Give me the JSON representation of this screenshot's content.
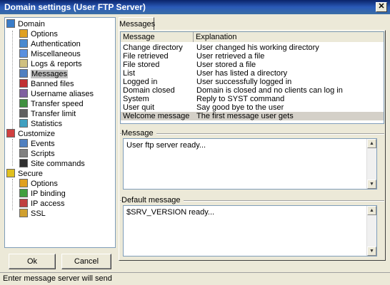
{
  "window": {
    "title": "Domain settings (User FTP Server)"
  },
  "tree": {
    "items": [
      {
        "label": "Domain",
        "icon": "domain-icon",
        "color": "#3a7dc9"
      },
      {
        "label": "Options",
        "icon": "options-icon",
        "color": "#e0a020"
      },
      {
        "label": "Authentication",
        "icon": "authentication-icon",
        "color": "#4a8ad0"
      },
      {
        "label": "Miscellaneous",
        "icon": "miscellaneous-icon",
        "color": "#5a90e0"
      },
      {
        "label": "Logs & reports",
        "icon": "logs-reports-icon",
        "color": "#d0c080"
      },
      {
        "label": "Messages",
        "icon": "messages-icon",
        "color": "#5080c0"
      },
      {
        "label": "Banned files",
        "icon": "banned-files-icon",
        "color": "#c03030"
      },
      {
        "label": "Username aliases",
        "icon": "username-aliases-icon",
        "color": "#8060a0"
      },
      {
        "label": "Transfer speed",
        "icon": "transfer-speed-icon",
        "color": "#409040"
      },
      {
        "label": "Transfer limit",
        "icon": "transfer-limit-icon",
        "color": "#606060"
      },
      {
        "label": "Statistics",
        "icon": "statistics-icon",
        "color": "#40a0c0"
      },
      {
        "label": "Customize",
        "icon": "customize-icon",
        "color": "#d04040"
      },
      {
        "label": "Events",
        "icon": "events-icon",
        "color": "#5080c0"
      },
      {
        "label": "Scripts",
        "icon": "scripts-icon",
        "color": "#808080"
      },
      {
        "label": "Site commands",
        "icon": "site-commands-icon",
        "color": "#303030"
      },
      {
        "label": "Secure",
        "icon": "secure-icon",
        "color": "#e0c020"
      },
      {
        "label": "Options",
        "icon": "secure-options-icon",
        "color": "#e0a020"
      },
      {
        "label": "IP binding",
        "icon": "ip-binding-icon",
        "color": "#40a040"
      },
      {
        "label": "IP access",
        "icon": "ip-access-icon",
        "color": "#c04040"
      },
      {
        "label": "SSL",
        "icon": "ssl-key-icon",
        "color": "#d0a030"
      }
    ]
  },
  "buttons": {
    "ok": "Ok",
    "cancel": "Cancel"
  },
  "tabs": {
    "messages": "Messages"
  },
  "messages_list": {
    "columns": [
      "Message",
      "Explanation"
    ],
    "rows": [
      {
        "message": "Change directory",
        "explanation": "User changed his working directory"
      },
      {
        "message": "File retrieved",
        "explanation": "User retrieved a file"
      },
      {
        "message": "File stored",
        "explanation": "User stored a file"
      },
      {
        "message": "List",
        "explanation": "User has listed a directory"
      },
      {
        "message": "Logged in",
        "explanation": "User successfully logged in"
      },
      {
        "message": "Domain closed",
        "explanation": "Domain is closed and no clients can log in"
      },
      {
        "message": "System",
        "explanation": "Reply to SYST command"
      },
      {
        "message": "User quit",
        "explanation": "Say good bye to the user"
      },
      {
        "message": "Welcome message",
        "explanation": "The first message user gets"
      }
    ],
    "selected": "Welcome message"
  },
  "message_group": {
    "label": "Message",
    "value": "User ftp server ready..."
  },
  "default_group": {
    "label": "Default message",
    "value": "$SRV_VERSION ready..."
  },
  "status": {
    "text": "Enter message server will send"
  }
}
